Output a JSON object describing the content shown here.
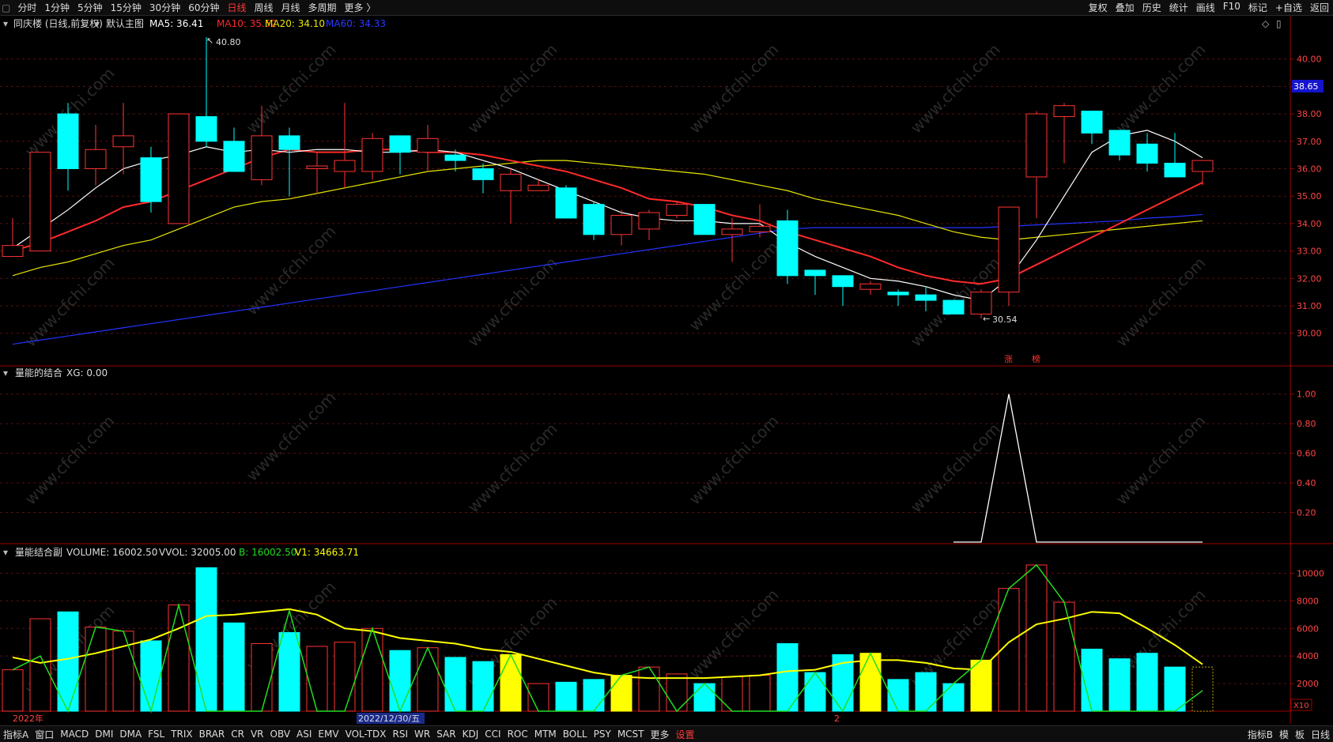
{
  "toolbar": {
    "periods": [
      "分时",
      "1分钟",
      "5分钟",
      "15分钟",
      "30分钟",
      "60分钟",
      "日线",
      "周线",
      "月线",
      "多周期",
      "更多 〉"
    ],
    "active_period": "日线",
    "right": [
      "复权",
      "叠加",
      "历史",
      "统计",
      "画线",
      "F10",
      "标记",
      "+自选",
      "返回"
    ]
  },
  "colors": {
    "up": "#ff3333",
    "down": "#00ffff",
    "ma5": "#ffffff",
    "ma10": "#ff2a2a",
    "ma20": "#e6e600",
    "ma60": "#2233ff",
    "signal": "#ffffff",
    "vvol": "#ffff00",
    "b": "#22dd22",
    "highlight": "#ffff00",
    "grid": "#5a1010",
    "axis": "#a00000"
  },
  "main_panel": {
    "title": "同庆楼 (日线,前复权)",
    "template": "默认主图",
    "ma5_label": "MA5: 36.41",
    "ma10_label": "MA10: 35.52",
    "ma20_label": "MA20: 34.10",
    "ma60_label": "MA60: 34.33",
    "high_label": "40.80",
    "low_label": "30.54",
    "price_tag": "38.65",
    "marks": [
      "涨",
      "榜"
    ],
    "y_ticks": [
      "40.00",
      "39.00",
      "38.00",
      "37.00",
      "36.00",
      "35.00",
      "34.00",
      "33.00",
      "32.00",
      "31.00",
      "30.00"
    ]
  },
  "panel2": {
    "title": "量能的结合",
    "xg_label": "XG: 0.00",
    "y_ticks": [
      "1.00",
      "0.80",
      "0.60",
      "0.40",
      "0.20"
    ]
  },
  "panel3": {
    "title": "量能结合副",
    "volume_label": "VOLUME: 16002.50",
    "vvol_label": "VVOL: 32005.00",
    "b_label": "B: 16002.50",
    "v1_label": "V1: 34663.71",
    "y_ticks": [
      "10000",
      "8000",
      "6000",
      "4000",
      "2000"
    ],
    "unit": "X10"
  },
  "x_labels": [
    "2022年",
    "2022/12/30/五",
    "2"
  ],
  "bottombar": {
    "left": [
      "指标A",
      "窗口",
      "MACD",
      "DMI",
      "DMA",
      "FSL",
      "TRIX",
      "BRAR",
      "CR",
      "VR",
      "OBV",
      "ASI",
      "EMV",
      "VOL-TDX",
      "RSI",
      "WR",
      "SAR",
      "KDJ",
      "CCI",
      "ROC",
      "MTM",
      "BOLL",
      "PSY",
      "MCST",
      "更多"
    ],
    "settings": "设置",
    "right": [
      "指标B",
      "模",
      "板",
      "日线"
    ]
  },
  "chart_data": [
    {
      "type": "candlestick",
      "title": "同庆楼 (日线,前复权)",
      "ylim": [
        29.3,
        41.0
      ],
      "candles": [
        {
          "o": 32.8,
          "c": 33.2,
          "h": 34.2,
          "l": 32.8
        },
        {
          "o": 33.0,
          "c": 36.6,
          "h": 36.6,
          "l": 33.0
        },
        {
          "o": 38.0,
          "c": 36.0,
          "h": 38.4,
          "l": 35.2
        },
        {
          "o": 36.0,
          "c": 36.7,
          "h": 37.6,
          "l": 35.4
        },
        {
          "o": 36.8,
          "c": 37.2,
          "h": 38.4,
          "l": 35.8
        },
        {
          "o": 36.4,
          "c": 34.8,
          "h": 36.8,
          "l": 34.4
        },
        {
          "o": 34.0,
          "c": 38.0,
          "h": 38.0,
          "l": 34.0
        },
        {
          "o": 37.9,
          "c": 37.0,
          "h": 40.8,
          "l": 36.8
        },
        {
          "o": 37.0,
          "c": 35.9,
          "h": 37.5,
          "l": 35.9
        },
        {
          "o": 35.6,
          "c": 37.2,
          "h": 38.3,
          "l": 35.4
        },
        {
          "o": 37.2,
          "c": 36.7,
          "h": 37.5,
          "l": 35.0
        },
        {
          "o": 36.0,
          "c": 36.1,
          "h": 36.6,
          "l": 35.1
        },
        {
          "o": 35.9,
          "c": 36.3,
          "h": 38.4,
          "l": 35.3
        },
        {
          "o": 35.9,
          "c": 37.1,
          "h": 37.3,
          "l": 35.6
        },
        {
          "o": 37.2,
          "c": 36.6,
          "h": 37.2,
          "l": 35.8
        },
        {
          "o": 36.6,
          "c": 37.1,
          "h": 37.6,
          "l": 35.9
        },
        {
          "o": 36.5,
          "c": 36.3,
          "h": 36.7,
          "l": 35.9
        },
        {
          "o": 36.0,
          "c": 35.6,
          "h": 36.2,
          "l": 35.1
        },
        {
          "o": 35.2,
          "c": 35.8,
          "h": 36.0,
          "l": 34.0
        },
        {
          "o": 35.2,
          "c": 35.4,
          "h": 35.6,
          "l": 35.2
        },
        {
          "o": 35.3,
          "c": 34.2,
          "h": 35.4,
          "l": 34.2
        },
        {
          "o": 34.7,
          "c": 33.6,
          "h": 34.8,
          "l": 33.4
        },
        {
          "o": 33.6,
          "c": 34.3,
          "h": 34.5,
          "l": 33.2
        },
        {
          "o": 33.8,
          "c": 34.4,
          "h": 34.5,
          "l": 33.4
        },
        {
          "o": 34.3,
          "c": 34.7,
          "h": 34.8,
          "l": 34.2
        },
        {
          "o": 34.7,
          "c": 33.6,
          "h": 34.7,
          "l": 33.6
        },
        {
          "o": 33.6,
          "c": 33.8,
          "h": 34.2,
          "l": 32.6
        },
        {
          "o": 33.7,
          "c": 33.9,
          "h": 34.7,
          "l": 33.5
        },
        {
          "o": 34.1,
          "c": 32.1,
          "h": 34.5,
          "l": 31.8
        },
        {
          "o": 32.3,
          "c": 32.1,
          "h": 32.3,
          "l": 31.4
        },
        {
          "o": 32.1,
          "c": 31.7,
          "h": 32.1,
          "l": 31.0
        },
        {
          "o": 31.6,
          "c": 31.8,
          "h": 31.9,
          "l": 31.4
        },
        {
          "o": 31.5,
          "c": 31.4,
          "h": 31.6,
          "l": 31.0
        },
        {
          "o": 31.4,
          "c": 31.2,
          "h": 31.7,
          "l": 30.8
        },
        {
          "o": 31.2,
          "c": 30.7,
          "h": 31.2,
          "l": 30.7
        },
        {
          "o": 30.7,
          "c": 31.5,
          "h": 31.6,
          "l": 30.54
        },
        {
          "o": 31.5,
          "c": 34.6,
          "h": 34.6,
          "l": 31.0
        },
        {
          "o": 35.7,
          "c": 38.0,
          "h": 38.1,
          "l": 34.2
        },
        {
          "o": 37.9,
          "c": 38.3,
          "h": 38.4,
          "l": 36.2
        },
        {
          "o": 38.1,
          "c": 37.3,
          "h": 38.1,
          "l": 36.9
        },
        {
          "o": 37.4,
          "c": 36.5,
          "h": 37.4,
          "l": 36.3
        },
        {
          "o": 36.9,
          "c": 36.2,
          "h": 37.3,
          "l": 35.9
        },
        {
          "o": 36.2,
          "c": 35.7,
          "h": 37.3,
          "l": 35.7
        },
        {
          "o": 35.9,
          "c": 36.3,
          "h": 36.3,
          "l": 35.4
        }
      ],
      "ma5": [
        33.1,
        33.8,
        34.5,
        35.3,
        36.0,
        36.3,
        36.5,
        36.8,
        36.6,
        36.7,
        36.6,
        36.7,
        36.7,
        36.6,
        36.6,
        36.7,
        36.6,
        36.3,
        36.0,
        35.6,
        35.2,
        34.8,
        34.4,
        34.2,
        34.1,
        34.1,
        34.0,
        34.0,
        33.3,
        32.8,
        32.4,
        32.0,
        31.9,
        31.7,
        31.4,
        31.2,
        32.0,
        33.4,
        35.0,
        36.6,
        37.2,
        37.4,
        37.0,
        36.4
      ],
      "ma10": [
        33.0,
        33.3,
        33.7,
        34.1,
        34.6,
        34.8,
        35.2,
        35.6,
        36.0,
        36.4,
        36.7,
        36.6,
        36.6,
        36.7,
        36.7,
        36.6,
        36.6,
        36.5,
        36.3,
        36.1,
        35.9,
        35.6,
        35.3,
        34.9,
        34.8,
        34.6,
        34.3,
        34.1,
        33.7,
        33.4,
        33.1,
        32.8,
        32.4,
        32.1,
        31.9,
        31.8,
        32.0,
        32.5,
        33.0,
        33.5,
        34.0,
        34.5,
        35.0,
        35.5
      ],
      "ma20": [
        32.1,
        32.4,
        32.6,
        32.9,
        33.2,
        33.4,
        33.8,
        34.2,
        34.6,
        34.8,
        34.9,
        35.1,
        35.3,
        35.5,
        35.7,
        35.9,
        36.0,
        36.1,
        36.2,
        36.3,
        36.3,
        36.2,
        36.1,
        36.0,
        35.9,
        35.8,
        35.6,
        35.4,
        35.2,
        34.9,
        34.7,
        34.5,
        34.3,
        34.0,
        33.7,
        33.5,
        33.4,
        33.5,
        33.6,
        33.7,
        33.8,
        33.9,
        34.0,
        34.1
      ],
      "ma60": [
        29.6,
        29.75,
        29.9,
        30.05,
        30.2,
        30.35,
        30.5,
        30.65,
        30.8,
        30.95,
        31.1,
        31.25,
        31.4,
        31.55,
        31.7,
        31.85,
        32.0,
        32.15,
        32.3,
        32.45,
        32.6,
        32.75,
        32.9,
        33.05,
        33.2,
        33.35,
        33.5,
        33.65,
        33.8,
        33.85,
        33.85,
        33.85,
        33.85,
        33.85,
        33.85,
        33.85,
        33.9,
        33.95,
        34.0,
        34.05,
        34.1,
        34.2,
        34.25,
        34.33
      ]
    },
    {
      "type": "line",
      "title": "量能的结合",
      "ylim": [
        0,
        1.1
      ],
      "series": [
        {
          "name": "XG",
          "values": [
            0,
            0,
            0,
            0,
            0,
            0,
            0,
            0,
            0,
            0,
            0,
            0,
            0,
            0,
            0,
            0,
            0,
            0,
            0,
            0,
            0,
            0,
            0,
            0,
            0,
            0,
            0,
            0,
            0,
            0,
            0,
            0,
            0,
            0,
            0,
            0,
            1,
            0,
            0,
            0,
            0,
            0,
            0,
            0
          ]
        }
      ]
    },
    {
      "type": "bar",
      "title": "量能结合副",
      "ylim": [
        0,
        11000
      ],
      "volume": [
        3000,
        6700,
        7200,
        6100,
        5800,
        5100,
        7700,
        10400,
        6400,
        4900,
        5700,
        4700,
        5000,
        6000,
        4400,
        4600,
        3900,
        3600,
        4100,
        2000,
        2100,
        2300,
        2600,
        3200,
        2700,
        2000,
        2500,
        2600,
        4900,
        2800,
        4100,
        4200,
        2300,
        2800,
        2000,
        3700,
        8900,
        10600,
        7900,
        4500,
        3800,
        4200,
        3200,
        3200
      ],
      "highlight": [
        0,
        0,
        0,
        0,
        0,
        0,
        0,
        0,
        0,
        0,
        0,
        0,
        0,
        0,
        0,
        0,
        0,
        0,
        1,
        0,
        0,
        0,
        1,
        0,
        0,
        0,
        0,
        0,
        0,
        0,
        0,
        1,
        0,
        0,
        0,
        1,
        0,
        0,
        0,
        0,
        0,
        0,
        0,
        0
      ],
      "vvol": [
        3900,
        3500,
        3800,
        4200,
        4700,
        5200,
        6000,
        6900,
        7000,
        7200,
        7400,
        7000,
        6000,
        5800,
        5300,
        5100,
        4900,
        4500,
        4300,
        3800,
        3300,
        2800,
        2500,
        2400,
        2400,
        2400,
        2500,
        2600,
        2900,
        3000,
        3500,
        3700,
        3700,
        3500,
        3100,
        3000,
        5000,
        6300,
        6700,
        7200,
        7100,
        6000,
        4800,
        3400
      ],
      "b": [
        3000,
        4000,
        0,
        6100,
        5800,
        0,
        7700,
        0,
        0,
        0,
        7300,
        0,
        0,
        6000,
        0,
        4600,
        0,
        0,
        4100,
        0,
        0,
        0,
        2600,
        3200,
        0,
        2000,
        0,
        0,
        0,
        2800,
        0,
        4200,
        0,
        0,
        2000,
        3700,
        8900,
        10600,
        7900,
        0,
        0,
        0,
        0,
        1500
      ]
    }
  ]
}
